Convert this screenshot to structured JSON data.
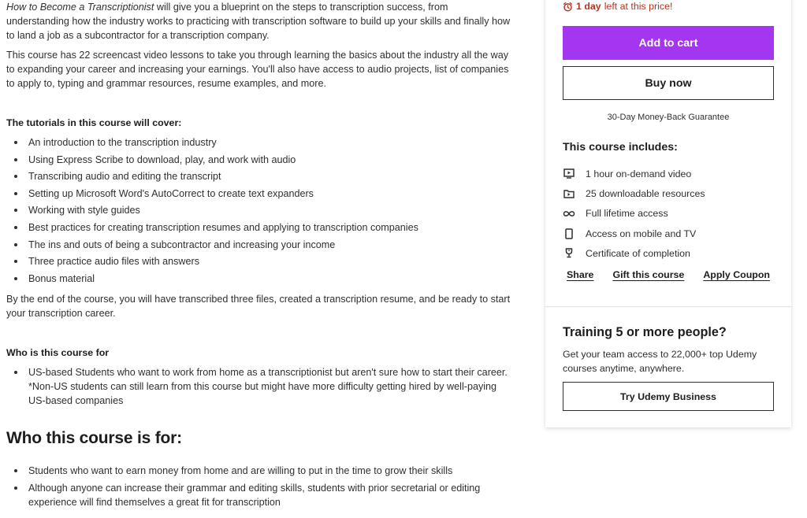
{
  "description": {
    "intro_title_italic": "How to Become a Transcriptionist",
    "intro_rest": " will give you a blueprint on the steps to transcription success, from understanding how the industry works to practicing with transcription software to build up your skills and finally how to land a job as a subcontractor for a transcription company.",
    "paragraph2": "This course has 22 screencast video lessons to take you through learning the basics about the industry all the way to expanding your career and increasing your earnings. You'll also have access to audio projects, list of companies to apply to, typing and grammar resources, resume examples, and more.",
    "tutorials_heading": "The tutorials in this course will cover:",
    "tutorials": [
      "An introduction to the transcription industry",
      "Using Express Scribe to download, play, and work with audio",
      "Transcribing audio and editing the transcript",
      "Setting up Microsoft Word's AutoCorrect to create text expanders",
      "Working with style guides",
      "Best practices for creating transcription resumes and applying to transcription companies",
      "The ins and outs of being a subcontractor and increasing your income",
      "Three practice audio files with answers",
      "Bonus material"
    ],
    "paragraph3": "By the end of the course, you will have transcribed three files, created a transcription resume, and be ready to start your transcription career.",
    "who_heading_small": "Who is this course for",
    "who_small_items": [
      "US-based Students who want to work from home as a transcriptionist but aren't sure how to start their career. *Non-US students can still learn from this course but might have more difficulty getting hired by well-paying US-based companies"
    ]
  },
  "audience": {
    "heading": "Who this course is for:",
    "items": [
      "Students who want to earn money from home and are willing to put in the time to grow their skills",
      "Although anyone can increase their grammar and editing skills, students with prior secretarial or editing experience will find themselves a great fit for transcription"
    ]
  },
  "purchase_card": {
    "countdown_icon": "alarm-clock-icon",
    "countdown_bold": "1 day",
    "countdown_rest": "left at this price!",
    "add_to_cart_label": "Add to cart",
    "buy_now_label": "Buy now",
    "guarantee": "30-Day Money-Back Guarantee",
    "includes_title": "This course includes:",
    "includes": [
      {
        "icon": "video-icon",
        "text": "1 hour on-demand video"
      },
      {
        "icon": "download-folder-icon",
        "text": "25 downloadable resources"
      },
      {
        "icon": "infinity-icon",
        "text": "Full lifetime access"
      },
      {
        "icon": "mobile-icon",
        "text": "Access on mobile and TV"
      },
      {
        "icon": "trophy-icon",
        "text": "Certificate of completion"
      }
    ],
    "links": {
      "share": "Share",
      "gift": "Gift this course",
      "coupon": "Apply Coupon"
    },
    "colors": {
      "primary": "#a435f0",
      "countdown": "#b4351e"
    }
  },
  "business": {
    "title": "Training 5 or more people?",
    "text": "Get your team access to 22,000+ top Udemy courses anytime, anywhere.",
    "button_label": "Try Udemy Business"
  }
}
